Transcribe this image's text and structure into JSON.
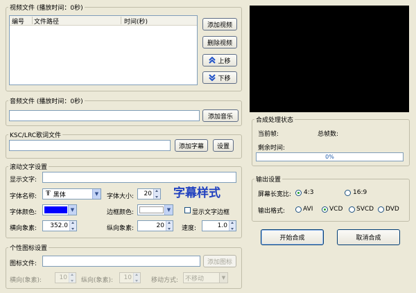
{
  "video": {
    "group_title": "视频文件 (播放时间：0秒)",
    "col_index": "编号",
    "col_path": "文件路径",
    "col_time": "时间(秒)",
    "add_label": "添加视频",
    "remove_label": "删除视频",
    "up_label": "上移",
    "down_label": "下移"
  },
  "audio": {
    "group_title": "音频文件 (播放时间：0秒)",
    "add_label": "添加音乐"
  },
  "lyrics": {
    "group_title": "KSC/LRC歌词文件",
    "add_label": "添加字幕",
    "settings_label": "设置"
  },
  "scroll": {
    "group_title": "滚动文字设置",
    "display_text_label": "显示文字:",
    "font_name_label": "字体名称:",
    "font_name_value": "黑体",
    "font_size_label": "字体大小:",
    "font_size_value": "20",
    "preview_label": "字幕样式",
    "font_color_label": "字体颜色:",
    "font_color_swatch": "#0000ff",
    "border_color_label": "边框颜色:",
    "border_color_swatch": "#ffffff",
    "show_border_label": "显示文字边框",
    "hpixel_label": "横向象素:",
    "hpixel_value": "352.0",
    "vpixel_label": "纵向象素:",
    "vpixel_value": "20",
    "speed_label": "速度:",
    "speed_value": "1.0"
  },
  "logo": {
    "group_title": "个性图标设置",
    "icon_file_label": "图标文件:",
    "add_label": "添加图标",
    "h_label": "横向(象素):",
    "h_value": "10",
    "v_label": "纵向(象素):",
    "v_value": "10",
    "move_label": "移动方式:",
    "move_value": "不移动"
  },
  "status": {
    "group_title": "合成处理状态",
    "current_frame_label": "当前帧:",
    "total_frames_label": "总帧数:",
    "remaining_label": "剩余时间:",
    "progress_text": "0%",
    "progress_fraction": 0
  },
  "output": {
    "group_title": "输出设置",
    "aspect_label": "屏幕长宽比:",
    "aspect_4_3": "4:3",
    "aspect_16_9": "16:9",
    "format_label": "输出格式:",
    "fmt_avi": "AVI",
    "fmt_vcd": "VCD",
    "fmt_svcd": "SVCD",
    "fmt_dvd": "DVD"
  },
  "actions": {
    "start_label": "开始合成",
    "cancel_label": "取消合成"
  },
  "colors": {
    "preview_text": "#1f3fbf",
    "progress_text": "#1c58a8",
    "up_down_arrow": "#2052c8"
  }
}
